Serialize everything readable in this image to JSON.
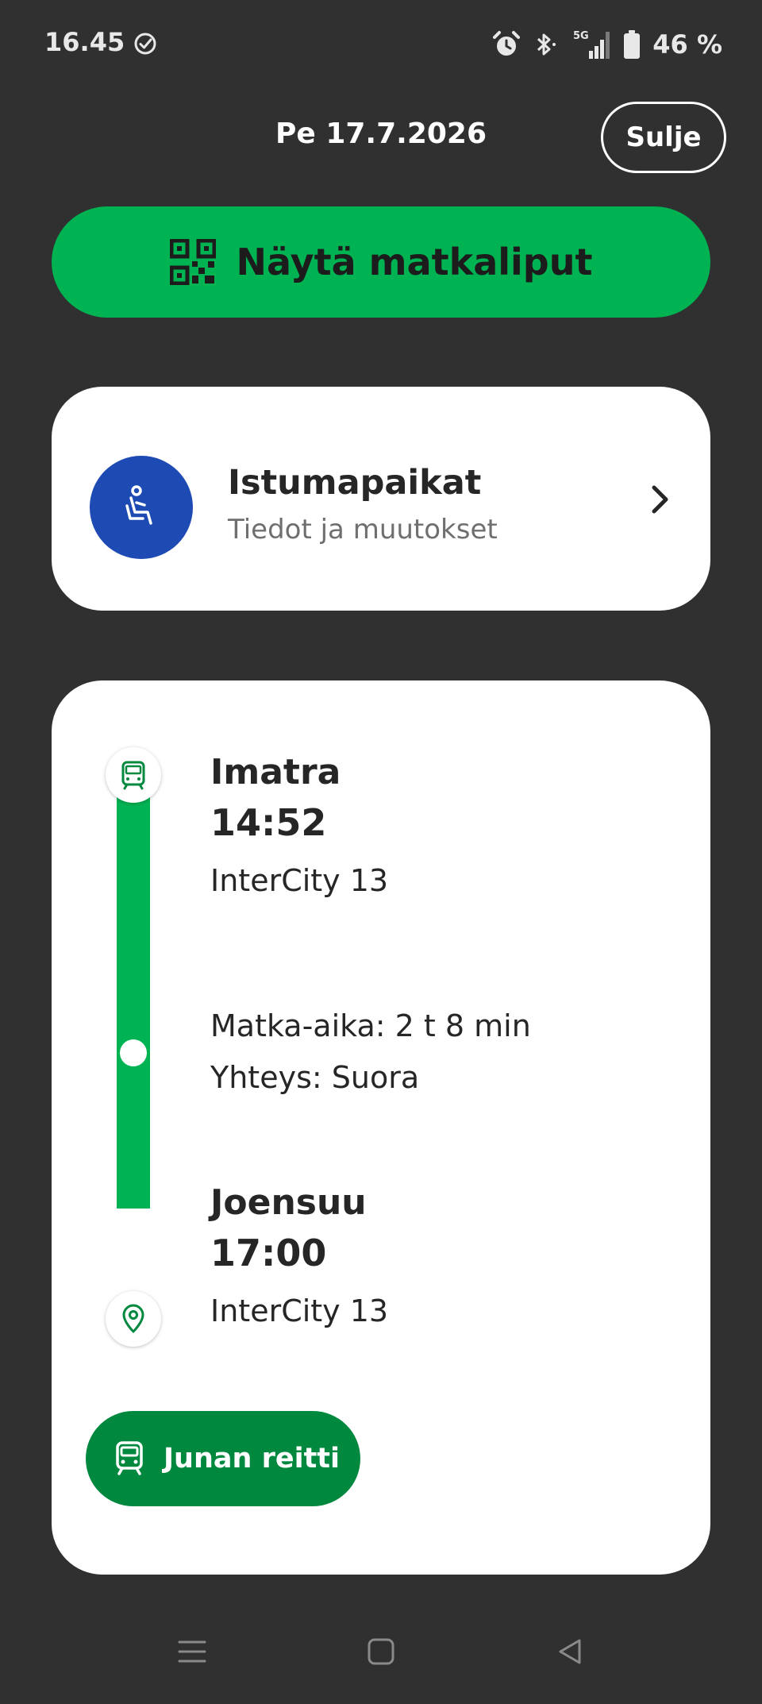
{
  "status_bar": {
    "time": "16.45",
    "battery_text": "46 %",
    "network_label": "5G",
    "icons": [
      "check-circle-icon",
      "alarm-icon",
      "bluetooth-icon",
      "signal-icon",
      "battery-icon"
    ]
  },
  "header": {
    "date": "Pe 17.7.2026",
    "close_label": "Sulje"
  },
  "tickets_button": {
    "label": "Näytä matkaliput",
    "icon": "qr-code-icon"
  },
  "seats_card": {
    "title": "Istumapaikat",
    "subtitle": "Tiedot ja muutokset",
    "icon": "seat-icon"
  },
  "journey": {
    "departure": {
      "station": "Imatra",
      "time": "14:52",
      "train": "InterCity 13"
    },
    "duration": "Matka-aika: 2 t 8 min",
    "connection": "Yhteys: Suora",
    "arrival": {
      "station": "Joensuu",
      "time": "17:00",
      "train": "InterCity 13"
    },
    "route_button_label": "Junan reitti"
  },
  "colors": {
    "background": "#303030",
    "primary_green": "#00b352",
    "dark_green": "#00883e",
    "seat_blue": "#1e4ab3",
    "card": "#ffffff",
    "text_dark": "#262626"
  }
}
